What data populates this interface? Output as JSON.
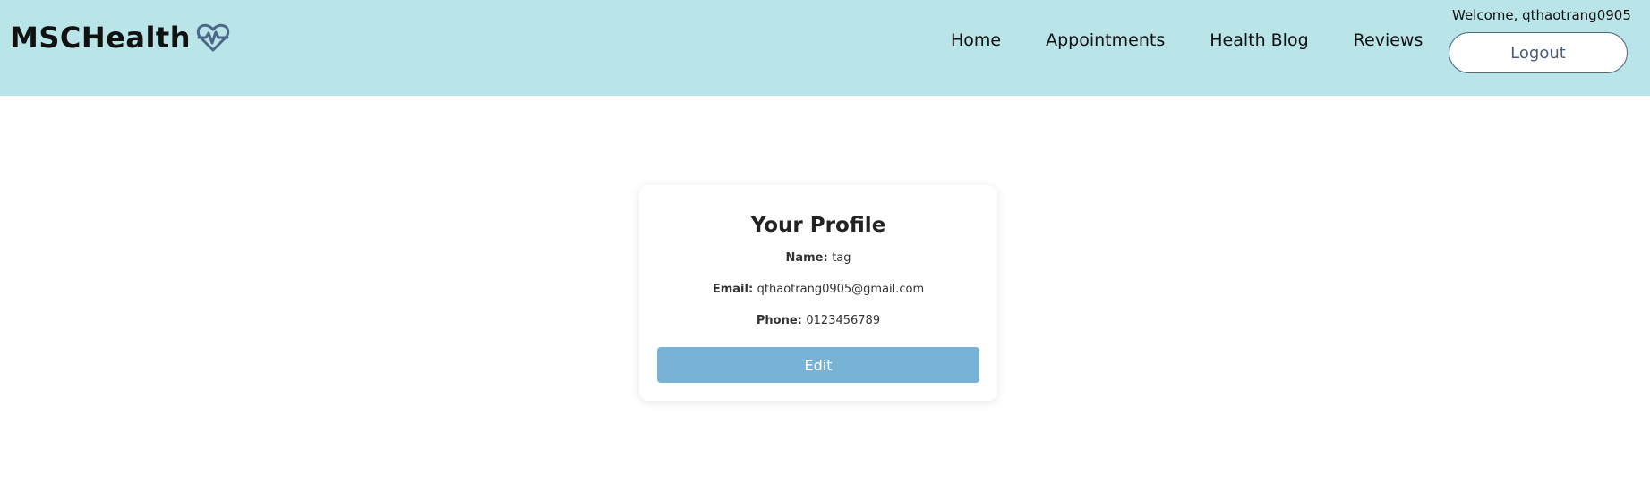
{
  "header": {
    "brand": "MSCHealth",
    "brand_icon": "heart-pulse-icon",
    "nav": {
      "home": "Home",
      "appointments": "Appointments",
      "health_blog": "Health Blog",
      "reviews": "Reviews"
    },
    "welcome": "Welcome, qthaotrang0905",
    "logout_label": "Logout"
  },
  "profile": {
    "title": "Your Profile",
    "name_label": "Name:",
    "name_value": "tag",
    "email_label": "Email:",
    "email_value": "qthaotrang0905@gmail.com",
    "phone_label": "Phone:",
    "phone_value": "0123456789",
    "edit_label": "Edit"
  },
  "colors": {
    "header_bg": "#b9e4e8",
    "edit_button_bg": "#78b2d4",
    "logout_border": "#4e6a86",
    "brand_icon": "#4c6788"
  }
}
